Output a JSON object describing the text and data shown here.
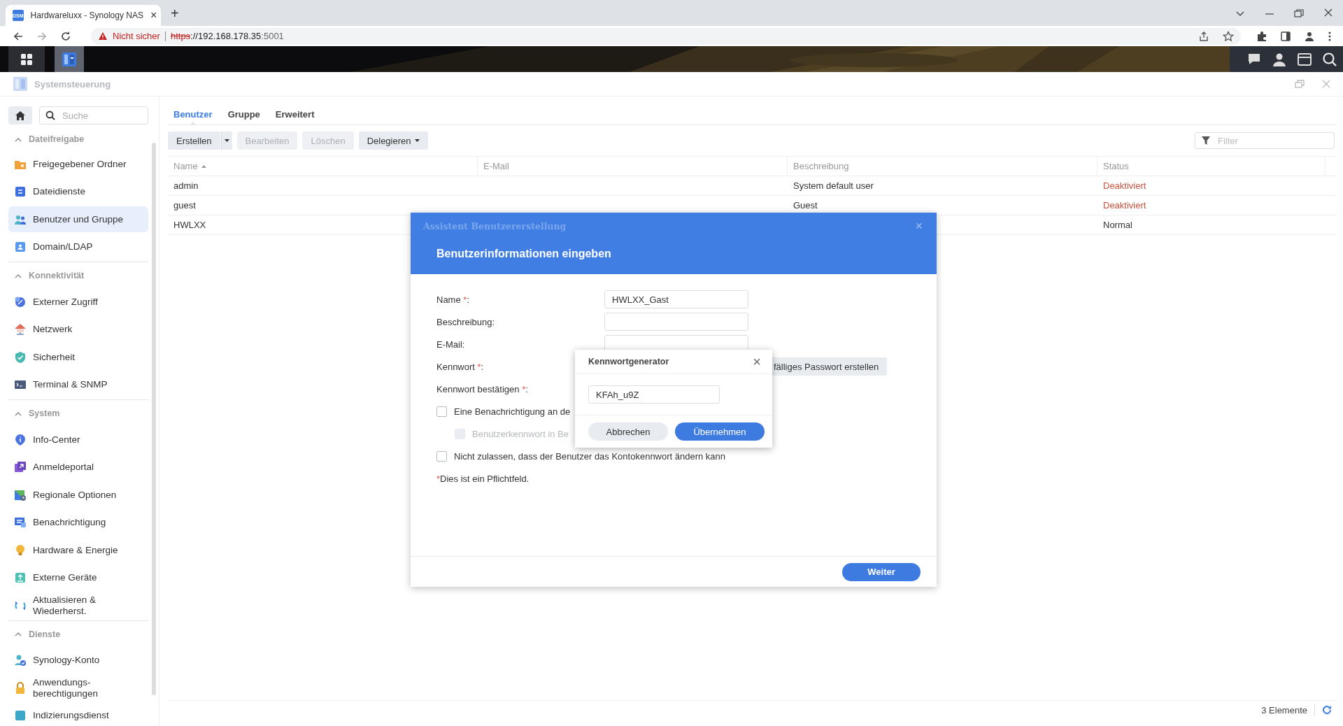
{
  "browser": {
    "tab": {
      "favicon": "DSM",
      "title": "Hardwareluxx - Synology NAS",
      "close": "×",
      "new_tab": "+"
    },
    "address": {
      "warning": "Nicht sicher",
      "scheme": "https",
      "host": "://192.168.178.35",
      "port": ":5001"
    }
  },
  "window": {
    "title": "Systemsteuerung"
  },
  "sidebar": {
    "search": {
      "placeholder": "Suche"
    },
    "sections": [
      {
        "title": "Dateifreigabe",
        "expanded": true,
        "items": [
          {
            "label": "Freigegebener Ordner",
            "selected": false
          },
          {
            "label": "Dateidienste",
            "selected": false
          },
          {
            "label": "Benutzer und Gruppe",
            "selected": true
          },
          {
            "label": "Domain/LDAP",
            "selected": false
          }
        ]
      },
      {
        "title": "Konnektivität",
        "expanded": true,
        "items": [
          {
            "label": "Externer Zugriff",
            "selected": false
          },
          {
            "label": "Netzwerk",
            "selected": false
          },
          {
            "label": "Sicherheit",
            "selected": false
          },
          {
            "label": "Terminal & SNMP",
            "selected": false
          }
        ]
      },
      {
        "title": "System",
        "expanded": true,
        "items": [
          {
            "label": "Info-Center",
            "selected": false
          },
          {
            "label": "Anmeldeportal",
            "selected": false
          },
          {
            "label": "Regionale Optionen",
            "selected": false
          },
          {
            "label": "Benachrichtigung",
            "selected": false
          },
          {
            "label": "Hardware & Energie",
            "selected": false
          },
          {
            "label": "Externe Geräte",
            "selected": false
          },
          {
            "label": "Aktualisieren & Wiederherst.",
            "selected": false
          }
        ]
      },
      {
        "title": "Dienste",
        "expanded": true,
        "items": [
          {
            "label": "Synology-Konto",
            "selected": false
          },
          {
            "label": "Anwendungs-berechtigungen",
            "selected": false
          },
          {
            "label": "Indizierungsdienst",
            "selected": false
          }
        ]
      }
    ]
  },
  "tabs": [
    {
      "label": "Benutzer",
      "selected": true
    },
    {
      "label": "Gruppe",
      "selected": false
    },
    {
      "label": "Erweitert",
      "selected": false
    }
  ],
  "toolbar": [
    {
      "label": "Erstellen",
      "disabled": false,
      "kind": "split"
    },
    {
      "label": "Bearbeiten",
      "disabled": true,
      "kind": "plain"
    },
    {
      "label": "Löschen",
      "disabled": true,
      "kind": "plain"
    },
    {
      "label": "Delegieren",
      "disabled": false,
      "kind": "menu"
    }
  ],
  "filter": {
    "placeholder": "Filter"
  },
  "table": {
    "columns": [
      {
        "label": "Name",
        "sorted": true
      },
      {
        "label": "E-Mail",
        "sorted": false
      },
      {
        "label": "Beschreibung",
        "sorted": false
      },
      {
        "label": "Status",
        "sorted": false
      }
    ],
    "rows": [
      {
        "name": "admin",
        "description": "System default user",
        "status": "Deaktiviert",
        "color": "#c9523b"
      },
      {
        "name": "guest",
        "description": "Guest",
        "status": "Deaktiviert",
        "color": "#c9523b"
      },
      {
        "name": "HWLXX",
        "status": "Normal",
        "color": "#333333"
      }
    ]
  },
  "status_bar": {
    "count": "3 Elemente"
  },
  "wizard": {
    "title": "Assistent Benutzererstellung",
    "close": "×",
    "heading": "Benutzerinformationen eingeben",
    "fields": [
      {
        "label": "Name",
        "required_mark": "*",
        "colon": ":",
        "value": "HWLXX_Gast",
        "kind": "input"
      },
      {
        "label": "Beschreibung:",
        "kind": "input"
      },
      {
        "label": "E-Mail:",
        "kind": "input"
      },
      {
        "label": "Kennwort",
        "required_mark": "*",
        "colon": ":",
        "button": "fälliges Passwort erstellen",
        "kind": "button"
      },
      {
        "label": "Kennwort bestätigen",
        "required_mark": "*",
        "colon": ":",
        "kind": "none"
      }
    ],
    "checkboxes": [
      {
        "label": "Eine Benachrichtigung an de",
        "checked": false,
        "disabled": false,
        "children": [
          {
            "label": "Benutzerkennwort in Be",
            "checked": false,
            "disabled": true
          }
        ]
      },
      {
        "label": "Nicht zulassen, dass der Benutzer das Kontokennwort ändern kann",
        "checked": false,
        "disabled": false
      }
    ],
    "note": {
      "mark": "*",
      "text": "Dies ist ein Pflichtfeld."
    },
    "next": "Weiter"
  },
  "generator": {
    "title": "Kennwortgenerator",
    "close": "×",
    "value": "KFAh_u9Z",
    "buttons": [
      {
        "label": "Abbrechen",
        "primary": false
      },
      {
        "label": "Übernehmen",
        "primary": true
      }
    ]
  }
}
